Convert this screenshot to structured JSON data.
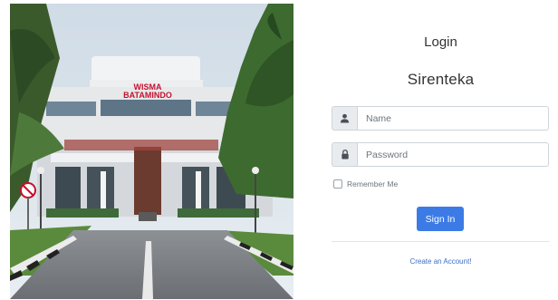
{
  "photo": {
    "alt": "Wisma Batamindo building",
    "sign_line1": "WISMA",
    "sign_line2": "BATAMINDO"
  },
  "login": {
    "heading": "Login",
    "app_name": "Sirenteka",
    "name_placeholder": "Name",
    "password_placeholder": "Password",
    "remember_label": "Remember Me",
    "sign_in_label": "Sign In",
    "create_account_label": "Create an Account!"
  },
  "colors": {
    "primary": "#3c7be6",
    "link": "#3c6fc8",
    "addon_bg": "#e9ecef"
  },
  "icons": {
    "name": "user-icon",
    "password": "lock-icon"
  }
}
